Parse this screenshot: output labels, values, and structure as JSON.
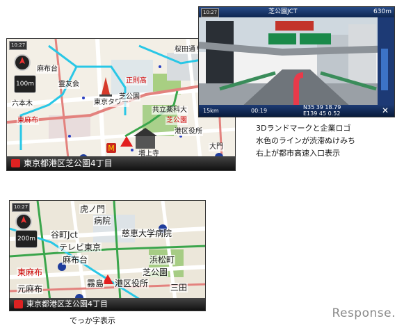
{
  "map1": {
    "signal_text": "10:27",
    "scale": "100m",
    "status": "東京都港区芝公園4丁目",
    "labels": {
      "azabu": "麻布台",
      "kyusei": "霊友会",
      "tokyo_tower": "東京タワー",
      "seishoji": "正則高",
      "shibako": "芝公園",
      "kyoritsu": "共立薬科大",
      "shiba_park2": "芝公園",
      "minato": "港区役所",
      "higashiazabu": "東麻布",
      "zojoji": "増上寺",
      "ropponmatsu": "六本木",
      "sakurada": "桜田通り",
      "daimon": "大門"
    }
  },
  "map2": {
    "signal_text": "10:27",
    "scale": "200m",
    "status": "東京都港区芝公園4丁目",
    "labels": {
      "toranomon": "虎ノ門",
      "hospital": "病院",
      "tanimachi": "谷町Jct",
      "jikei": "慈恵大学病院",
      "tv": "テレビ東京",
      "azabudai": "麻布台",
      "hamamatsu": "浜松町",
      "higashiazabu": "東麻布",
      "shibako": "芝公園",
      "motoazabu": "元麻布",
      "kirishima": "霧島",
      "mita": "三田",
      "minato": "港区役所"
    }
  },
  "jct": {
    "signal_text": "10:27",
    "title": "芝公園JCT",
    "distance": "630m",
    "bottom_left": "15km",
    "time": "00:19",
    "coords_n": "N35 39 18.79",
    "coords_e": "E139 45 0.52",
    "close": "✕"
  },
  "captions": {
    "line1": "3Dランドマークと企業ロゴ",
    "line2": "水色のラインが渋滞ぬけみち",
    "line3": "右上が都市高速入口表示",
    "big_text": "でっか字表示"
  },
  "logo": "Response."
}
